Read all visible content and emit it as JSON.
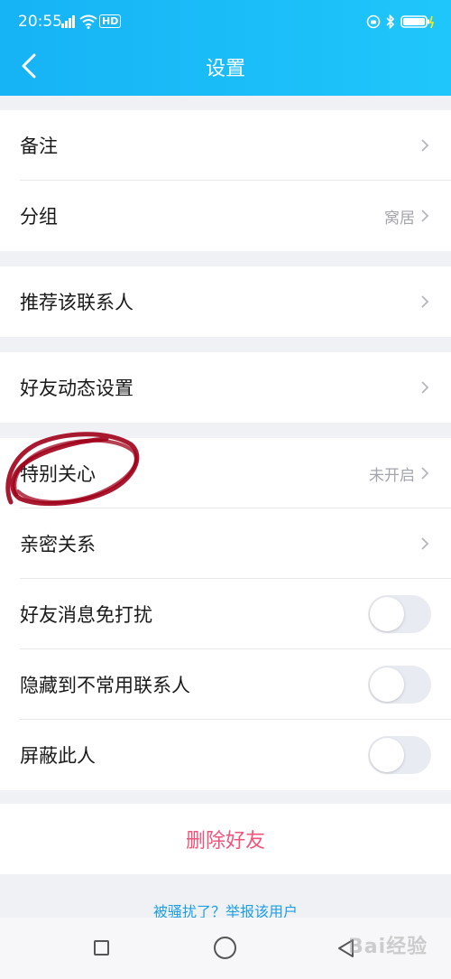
{
  "status_bar": {
    "time": "20:55",
    "network_badge": "HD",
    "icons": [
      "signal-icon",
      "wifi-icon",
      "hd-icon",
      "alarm-icon",
      "bluetooth-icon",
      "battery-icon"
    ]
  },
  "header": {
    "title": "设置",
    "back_icon": "chevron-left-icon"
  },
  "groups": [
    {
      "items": [
        {
          "label": "备注",
          "value": ""
        },
        {
          "label": "分组",
          "value": "窝居"
        }
      ]
    },
    {
      "items": [
        {
          "label": "推荐该联系人",
          "value": ""
        }
      ]
    },
    {
      "items": [
        {
          "label": "好友动态设置",
          "value": ""
        }
      ]
    },
    {
      "items": [
        {
          "label": "特别关心",
          "value": "未开启"
        },
        {
          "label": "亲密关系",
          "value": ""
        },
        {
          "label": "好友消息免打扰",
          "toggle": false
        },
        {
          "label": "隐藏到不常用联系人",
          "toggle": false
        },
        {
          "label": "屏蔽此人",
          "toggle": false
        }
      ]
    }
  ],
  "delete_button": "删除好友",
  "report_link": "被骚扰了？举报该用户",
  "watermark": "Bai经验",
  "colors": {
    "header": "#16b3f5",
    "danger": "#f0547a",
    "link": "#1e9ee6",
    "annotation": "#a0001a"
  }
}
